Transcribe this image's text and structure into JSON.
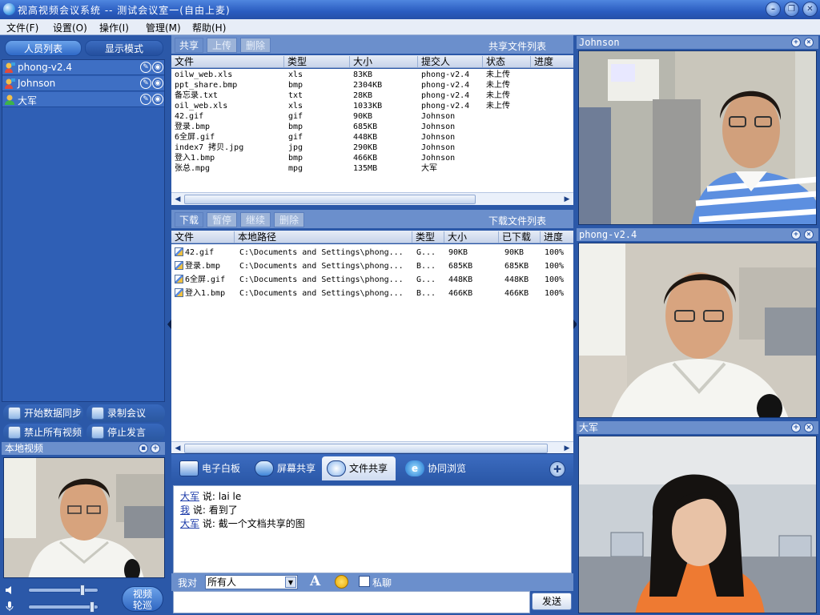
{
  "window": {
    "title": "视高视频会议系统  -- 测试会议室一(自由上麦)",
    "buttons": {
      "minimize": "–",
      "restore": "❐",
      "close": "✕"
    }
  },
  "menu": [
    {
      "label": "文件(F)"
    },
    {
      "label": "设置(O)"
    },
    {
      "label": "操作(I)"
    },
    {
      "label": "管理(M)"
    },
    {
      "label": "帮助(H)"
    }
  ],
  "left": {
    "tabs": {
      "people": "人员列表",
      "display": "显示模式"
    },
    "people": [
      {
        "name": "phong-v2.4",
        "icon": "user-with-video-icon"
      },
      {
        "name": "Johnson",
        "icon": "user-with-video-icon"
      },
      {
        "name": "大军",
        "icon": "user-icon"
      }
    ],
    "actions": {
      "start_sync": "开始数据同步",
      "record": "录制会议",
      "ban_video": "禁止所有视频",
      "stop_speaking": "停止发言"
    },
    "local_video_title": "本地视频",
    "volume_level": 0.8,
    "mic_level": 0.95,
    "rotate_label_1": "视频",
    "rotate_label_2": "轮巡"
  },
  "share": {
    "buttons": {
      "share": "共享",
      "upload": "上传",
      "delete": "删除"
    },
    "title": "共享文件列表",
    "columns": [
      "文件",
      "类型",
      "大小",
      "提交人",
      "状态",
      "进度"
    ],
    "rows": [
      [
        "oilw_web.xls",
        "xls",
        "83KB",
        "phong-v2.4",
        "未上传",
        ""
      ],
      [
        "ppt_share.bmp",
        "bmp",
        "2304KB",
        "phong-v2.4",
        "未上传",
        ""
      ],
      [
        "备忘录.txt",
        "txt",
        "28KB",
        "phong-v2.4",
        "未上传",
        ""
      ],
      [
        "oil_web.xls",
        "xls",
        "1033KB",
        "phong-v2.4",
        "未上传",
        ""
      ],
      [
        "42.gif",
        "gif",
        "90KB",
        "Johnson",
        "",
        ""
      ],
      [
        "登录.bmp",
        "bmp",
        "685KB",
        "Johnson",
        "",
        ""
      ],
      [
        "6全屏.gif",
        "gif",
        "448KB",
        "Johnson",
        "",
        ""
      ],
      [
        "index7 拷贝.jpg",
        "jpg",
        "290KB",
        "Johnson",
        "",
        ""
      ],
      [
        "登入1.bmp",
        "bmp",
        "466KB",
        "Johnson",
        "",
        ""
      ],
      [
        "张总.mpg",
        "mpg",
        "135MB",
        "大军",
        "",
        ""
      ]
    ]
  },
  "download": {
    "buttons": {
      "download": "下载",
      "pause": "暂停",
      "resume": "继续",
      "delete": "删除"
    },
    "title": "下载文件列表",
    "columns": [
      "文件",
      "本地路径",
      "类型",
      "大小",
      "已下载",
      "进度"
    ],
    "rows": [
      [
        "42.gif",
        "C:\\Documents and Settings\\phong...",
        "G...",
        "90KB",
        "90KB",
        "100%"
      ],
      [
        "登录.bmp",
        "C:\\Documents and Settings\\phong...",
        "B...",
        "685KB",
        "685KB",
        "100%"
      ],
      [
        "6全屏.gif",
        "C:\\Documents and Settings\\phong...",
        "G...",
        "448KB",
        "448KB",
        "100%"
      ],
      [
        "登入1.bmp",
        "C:\\Documents and Settings\\phong...",
        "B...",
        "466KB",
        "466KB",
        "100%"
      ]
    ]
  },
  "tools": {
    "whiteboard": "电子白板",
    "screen_share": "屏幕共享",
    "file_share": "文件共享",
    "co_browse": "协同浏览"
  },
  "chat": {
    "messages": [
      {
        "who": "大军",
        "said": "说:",
        "text": "lai le"
      },
      {
        "who": "我",
        "said": "说:",
        "text": "看到了"
      },
      {
        "who": "大军",
        "said": "说:",
        "text": "截一个文档共享的图"
      }
    ],
    "to_label": "我对",
    "to_value": "所有人",
    "font_glyph": "A",
    "private_label": "私聊",
    "send_label": "发送"
  },
  "videos": [
    {
      "name": "Johnson"
    },
    {
      "name": "phong-v2.4"
    },
    {
      "name": "大军"
    }
  ]
}
